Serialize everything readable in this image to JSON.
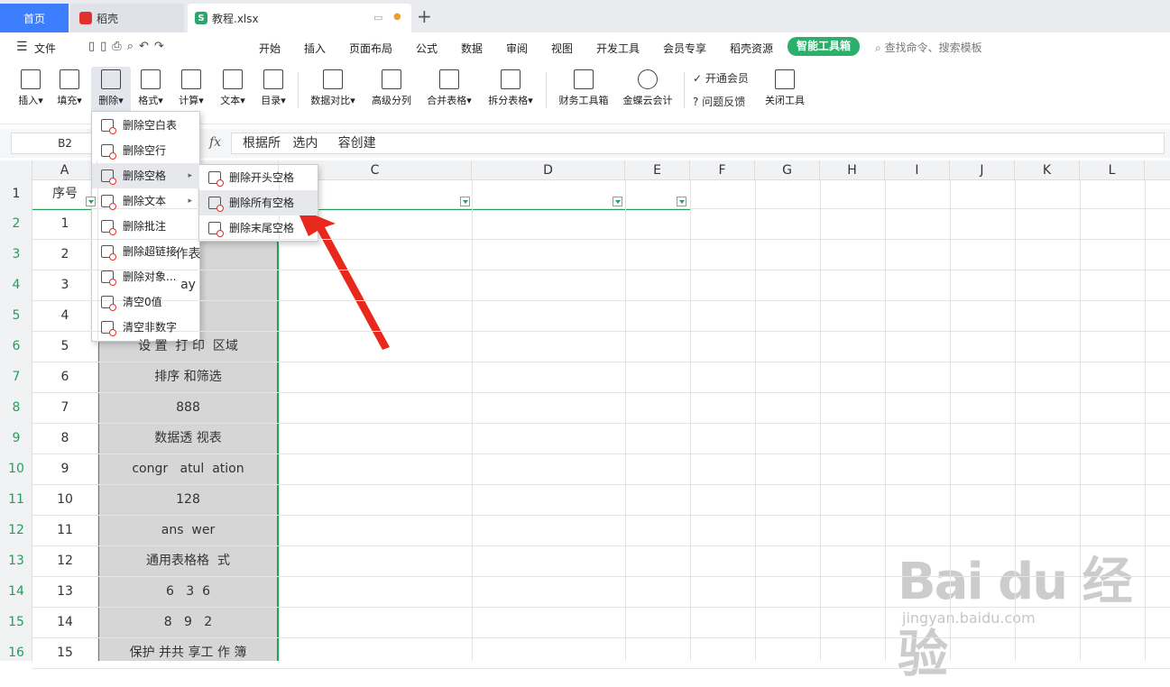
{
  "tabs": {
    "home": "首页",
    "daoke": "稻壳",
    "doc": "教程.xlsx",
    "plus": "+"
  },
  "menu": {
    "file": "文件",
    "items": [
      "开始",
      "插入",
      "页面布局",
      "公式",
      "数据",
      "审阅",
      "视图",
      "开发工具",
      "会员专享",
      "稻壳资源"
    ],
    "smart": "智能工具箱",
    "search": "查找命令、搜索模板"
  },
  "ribbon": {
    "insert": "插入",
    "fill": "填充",
    "delete": "删除",
    "format": "格式",
    "calc": "计算",
    "text": "文本",
    "toc": "目录",
    "compare": "数据对比",
    "split_adv": "高级分列",
    "merge": "合并表格",
    "split_tbl": "拆分表格",
    "finance": "财务工具箱",
    "kingdee": "金蝶云会计",
    "vip": "开通会员",
    "feedback": "问题反馈",
    "close": "关闭工具"
  },
  "formula": {
    "cell": "B2",
    "fx": "fx",
    "value": "根据所   选内     容创建"
  },
  "columns": [
    "A",
    "B",
    "C",
    "D",
    "E",
    "F",
    "G",
    "H",
    "I",
    "J",
    "K",
    "L"
  ],
  "rows": [
    "1",
    "2",
    "3",
    "4",
    "5",
    "6",
    "7",
    "8",
    "9",
    "10",
    "11",
    "12",
    "13",
    "14",
    "15",
    "16"
  ],
  "colA": [
    "序号",
    "1",
    "2",
    "3",
    "4",
    "5",
    "6",
    "7",
    "8",
    "9",
    "10",
    "11",
    "12",
    "13",
    "14",
    "15"
  ],
  "colB": [
    "",
    "",
    "作表",
    "ay",
    "",
    "设 置  打 印  区域",
    "排序 和筛选",
    "888",
    "数据透 视表",
    "congr   atul  ation",
    "128",
    "ans  wer",
    "通用表格格  式",
    "6   3  6",
    "8   9   2",
    "保护 并共 享工 作 簿"
  ],
  "dropdown": [
    "删除空白表",
    "删除空行",
    "删除空格",
    "删除文本",
    "删除批注",
    "删除超链接",
    "删除对象...",
    "清空0值",
    "清空非数字"
  ],
  "submenu": [
    "删除开头空格",
    "删除所有空格",
    "删除末尾空格"
  ],
  "watermark": {
    "main": "Bai du 经验",
    "url": "jingyan.baidu.com"
  },
  "colors": {
    "accent": "#22a05a",
    "tab_active": "#3d7eff",
    "arrow": "#e8281c"
  }
}
